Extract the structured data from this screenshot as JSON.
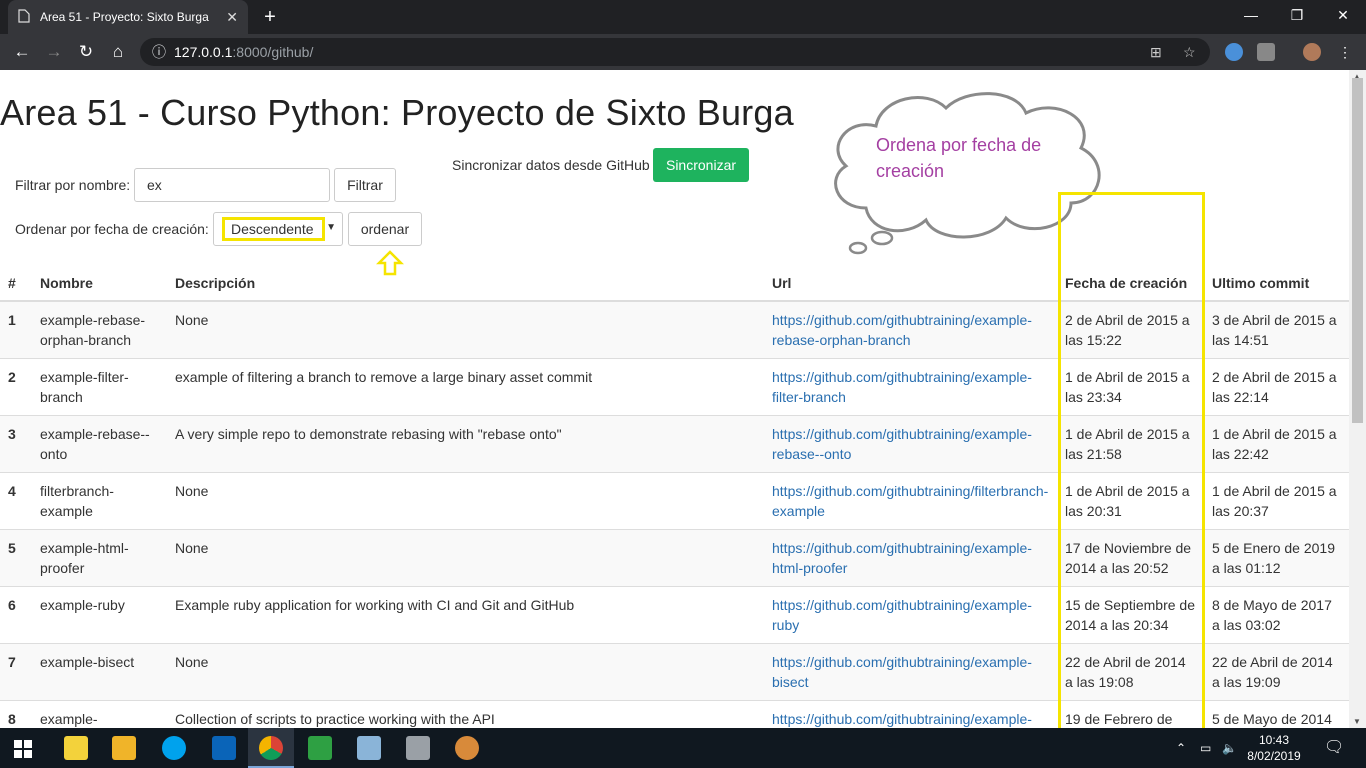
{
  "browser": {
    "tab_title": "Area 51 - Proyecto: Sixto Burga",
    "new_tab": "+",
    "url_host": "127.0.0.1",
    "url_path": ":8000/github/",
    "window_minimize": "—",
    "window_maximize": "❐",
    "window_close": "✕"
  },
  "page": {
    "title": "Area 51 - Curso Python: Proyecto de Sixto Burga",
    "filter_label": "Filtrar por nombre:",
    "filter_value": "ex",
    "filter_button": "Filtrar",
    "sort_label": "Ordenar por fecha de creación:",
    "sort_value": "Descendente",
    "sort_button": "ordenar",
    "sync_label": "Sincronizar datos desde GitHub",
    "sync_button": "Sincronizar",
    "annotation": "Ordena por fecha de creación"
  },
  "table": {
    "headers": [
      "#",
      "Nombre",
      "Descripción",
      "Url",
      "Fecha de creación",
      "Ultimo commit"
    ],
    "rows": [
      {
        "num": "1",
        "name": "example-rebase-orphan-branch",
        "desc": "None",
        "url": "https://github.com/githubtraining/example-rebase-orphan-branch",
        "created": "2 de Abril de 2015 a las 15:22",
        "commit": "3 de Abril de 2015 a las 14:51"
      },
      {
        "num": "2",
        "name": "example-filter-branch",
        "desc": "example of filtering a branch to remove a large binary asset commit",
        "url": "https://github.com/githubtraining/example-filter-branch",
        "created": "1 de Abril de 2015 a las 23:34",
        "commit": "2 de Abril de 2015 a las 22:14"
      },
      {
        "num": "3",
        "name": "example-rebase--onto",
        "desc": "A very simple repo to demonstrate rebasing with \"rebase onto\"",
        "url": "https://github.com/githubtraining/example-rebase--onto",
        "created": "1 de Abril de 2015 a las 21:58",
        "commit": "1 de Abril de 2015 a las 22:42"
      },
      {
        "num": "4",
        "name": "filterbranch-example",
        "desc": "None",
        "url": "https://github.com/githubtraining/filterbranch-example",
        "created": "1 de Abril de 2015 a las 20:31",
        "commit": "1 de Abril de 2015 a las 20:37"
      },
      {
        "num": "5",
        "name": "example-html-proofer",
        "desc": "None",
        "url": "https://github.com/githubtraining/example-html-proofer",
        "created": "17 de Noviembre de 2014 a las 20:52",
        "commit": "5 de Enero de 2019 a las 01:12"
      },
      {
        "num": "6",
        "name": "example-ruby",
        "desc": "Example ruby application for working with CI and Git and GitHub",
        "url": "https://github.com/githubtraining/example-ruby",
        "created": "15 de Septiembre de 2014 a las 20:34",
        "commit": "8 de Mayo de 2017 a las 03:02"
      },
      {
        "num": "7",
        "name": "example-bisect",
        "desc": "None",
        "url": "https://github.com/githubtraining/example-bisect",
        "created": "22 de Abril de 2014 a las 19:08",
        "commit": "22 de Abril de 2014 a las 19:09"
      },
      {
        "num": "8",
        "name": "example-",
        "desc": "Collection of scripts to practice working with the API",
        "url": "https://github.com/githubtraining/example-",
        "created": "19 de Febrero de",
        "commit": "5 de Mayo de 2014"
      }
    ]
  },
  "taskbar": {
    "time": "10:43",
    "date": "8/02/2019"
  }
}
